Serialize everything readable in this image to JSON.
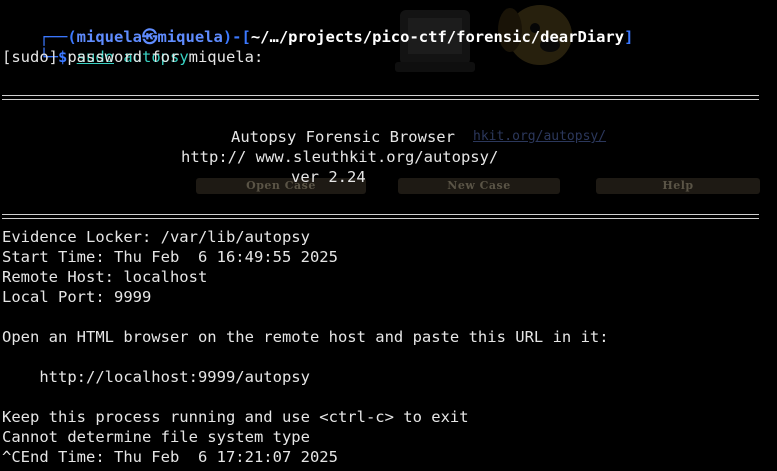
{
  "prompt": {
    "corner_top": "┌──(",
    "user": "miquela",
    "at_symbol": "㉿",
    "host": "miquela",
    "mid": ")-[",
    "path": "~/…/projects/pico-ctf/forensic/dearDiary",
    "close": "]",
    "corner_bottom": "└─",
    "dollar": "$",
    "command_sudo": "sudo",
    "command_rest": "autopsy"
  },
  "sudo_prompt": "[sudo] password for miquela:",
  "banner": {
    "title": "Autopsy Forensic Browser",
    "url": "http:// www.sleuthkit.org/autopsy/",
    "version": "ver 2.24"
  },
  "background": {
    "link": "hkit.org/autopsy/",
    "buttons": [
      "Open Case",
      "New Case",
      "Help"
    ]
  },
  "info": {
    "evidence_locker": "Evidence Locker: /var/lib/autopsy",
    "start_time": "Start Time: Thu Feb  6 16:49:55 2025",
    "remote_host": "Remote Host: localhost",
    "local_port": "Local Port: 9999"
  },
  "instructions": {
    "open_browser": "Open an HTML browser on the remote host and paste this URL in it:",
    "url": "    http://localhost:9999/autopsy",
    "keep_running": "Keep this process running and use <ctrl-c> to exit",
    "fs_error": "Cannot determine file system type",
    "end_time": "^CEnd Time: Thu Feb  6 17:21:07 2025"
  },
  "colors": {
    "background": "#000000",
    "text": "#e6e6e6",
    "prompt_blue": "#3b78ff",
    "command_cyan": "#38d1c2"
  }
}
